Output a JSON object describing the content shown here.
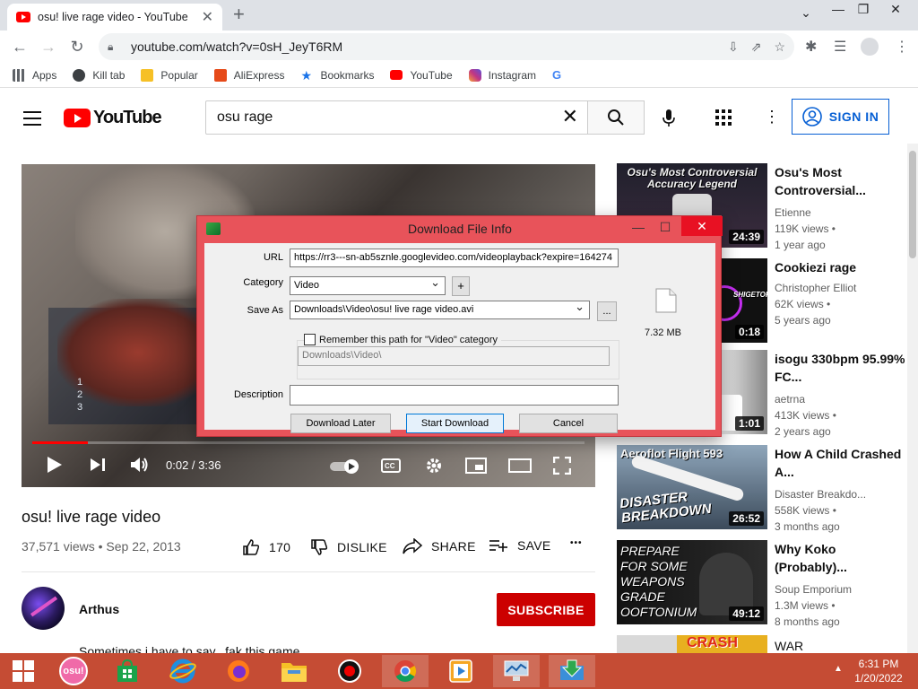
{
  "browser": {
    "tab_title": "osu! live rage video - YouTube",
    "url": "youtube.com/watch?v=0sH_JeyT6RM",
    "bookmarks": [
      {
        "label": "Apps",
        "color": "#5f6368"
      },
      {
        "label": "Kill tab",
        "color": "#3c4043"
      },
      {
        "label": "Popular",
        "color": "#f6c026"
      },
      {
        "label": "AliExpress",
        "color": "#e64a19"
      },
      {
        "label": "Bookmarks",
        "color": "#1a73e8"
      },
      {
        "label": "YouTube",
        "color": "#ff0000"
      },
      {
        "label": "Instagram",
        "color": "#c13584"
      },
      {
        "label": "",
        "color": "#4285f4"
      }
    ]
  },
  "youtube": {
    "logo_text": "YouTube",
    "search_value": "osu rage",
    "signin_label": "SIGN IN",
    "video": {
      "time": "0:02 / 3:36",
      "progress_fraction": 0.01,
      "overlay_numbers": [
        "1",
        "2",
        "3"
      ],
      "title": "osu! live rage video",
      "meta": "37,571 views • Sep 22, 2013",
      "likes": "170",
      "dislike_label": "DISLIKE",
      "share_label": "SHARE",
      "save_label": "SAVE",
      "more_label": "•••",
      "channel": "Arthus",
      "subscribe_label": "SUBSCRIBE",
      "description": "Sometimes i have to say.. fak this game"
    },
    "recommendations": [
      {
        "title": "Osu's Most Controversial...",
        "channel": "Etienne",
        "views": "119K views •",
        "age": "1 year ago",
        "duration": "24:39",
        "thumb_text": "Osu's Most Controversial Accuracy Legend",
        "thumb_color": "#1b1b24"
      },
      {
        "title": "Cookiezi rage",
        "channel": "Christopher Elliot",
        "views": "62K views •",
        "age": "5 years ago",
        "duration": "0:18",
        "thumb_text": "SHIGETORA",
        "thumb_color": "#141414"
      },
      {
        "title": "isogu 330bpm 95.99% FC...",
        "channel": "aetrna",
        "views": "413K views •",
        "age": "2 years ago",
        "duration": "1:01",
        "thumb_text": "",
        "thumb_color": "#1e1e1e"
      },
      {
        "title": "How A Child Crashed A...",
        "channel": "Disaster Breakdo...",
        "views": "558K views •",
        "age": "3 months ago",
        "duration": "26:52",
        "thumb_text": "Aeroflot Flight 593",
        "thumb_text2": "DISASTER BREAKDOWN",
        "thumb_color": "#3b4a5a"
      },
      {
        "title": "Why Koko (Probably)...",
        "channel": "Soup Emporium",
        "views": "1.3M views •",
        "age": "8 months ago",
        "duration": "49:12",
        "thumb_text": "PREPARE FOR SOME WEAPONS GRADE OOFTONIUM",
        "thumb_color": "#1a1a1a"
      },
      {
        "title": "WAR",
        "channel": "",
        "views": "",
        "age": "",
        "duration": "",
        "thumb_text": "CRASH",
        "thumb_color": "#e8b020"
      }
    ]
  },
  "dialog": {
    "title": "Download File Info",
    "url_label": "URL",
    "url_value": "https://rr3---sn-ab5sznle.googlevideo.com/videoplayback?expire=164274",
    "category_label": "Category",
    "category_value": "Video",
    "add_label": "+",
    "saveas_label": "Save As",
    "saveas_value": "Downloads\\Video\\osu! live rage video.avi",
    "browse_label": "...",
    "remember_label": "Remember this path for \"Video\" category",
    "remember_path": "Downloads\\Video\\",
    "description_label": "Description",
    "description_value": "",
    "file_size": "7.32 MB",
    "btn_later": "Download Later",
    "btn_start": "Start Download",
    "btn_cancel": "Cancel",
    "minimize": "—",
    "maximize": "☐",
    "close": "✕"
  },
  "taskbar": {
    "osu_label": "osu!",
    "time": "6:31 PM",
    "date": "1/20/2022",
    "tray_arrow": "▲"
  }
}
